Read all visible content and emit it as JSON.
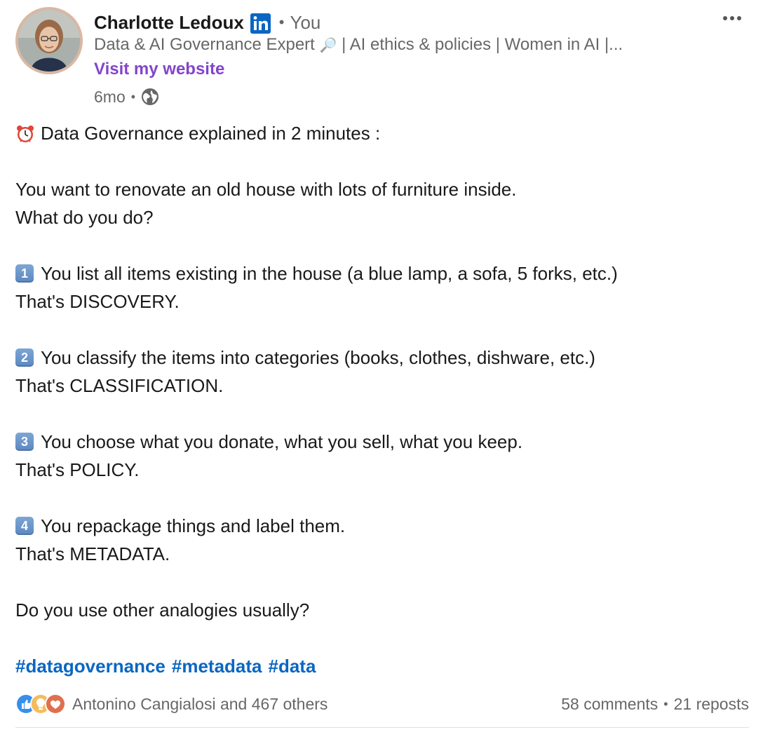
{
  "author": {
    "name": "Charlotte Ledoux",
    "degree": "You",
    "headline": "Data & AI Governance Expert",
    "headline_rest": " | AI ethics & policies | Women in AI |...",
    "website_label": "Visit my website",
    "time_ago": "6mo"
  },
  "post": {
    "lines": [
      "Data Governance explained in 2 minutes :",
      "You want to renovate an old house with lots of furniture inside.",
      "What do you do?",
      "You list all items existing in the house (a blue lamp, a sofa, 5 forks, etc.)",
      "That's DISCOVERY.",
      "You classify the items into categories (books, clothes, dishware, etc.)",
      "That's CLASSIFICATION.",
      "You choose what you donate, what you sell, what you keep.",
      "That's POLICY.",
      "You repackage things and label them.",
      "That's METADATA.",
      "Do you use other analogies usually?"
    ],
    "keycaps": [
      "1",
      "2",
      "3",
      "4"
    ],
    "hashtags": [
      "#datagovernance",
      "#metadata",
      "#data"
    ]
  },
  "social": {
    "reactors": "Antonino Cangialosi and 467 others",
    "comments": "58 comments",
    "reposts": "21 reposts"
  },
  "icons": {
    "verified": "linkedin-badge-icon",
    "visibility": "globe-icon",
    "menu": "more-icon",
    "alarm": "alarm-clock-icon"
  },
  "colors": {
    "link": "#0a66c2",
    "website": "#8344cc",
    "secondary_text": "#666666"
  }
}
